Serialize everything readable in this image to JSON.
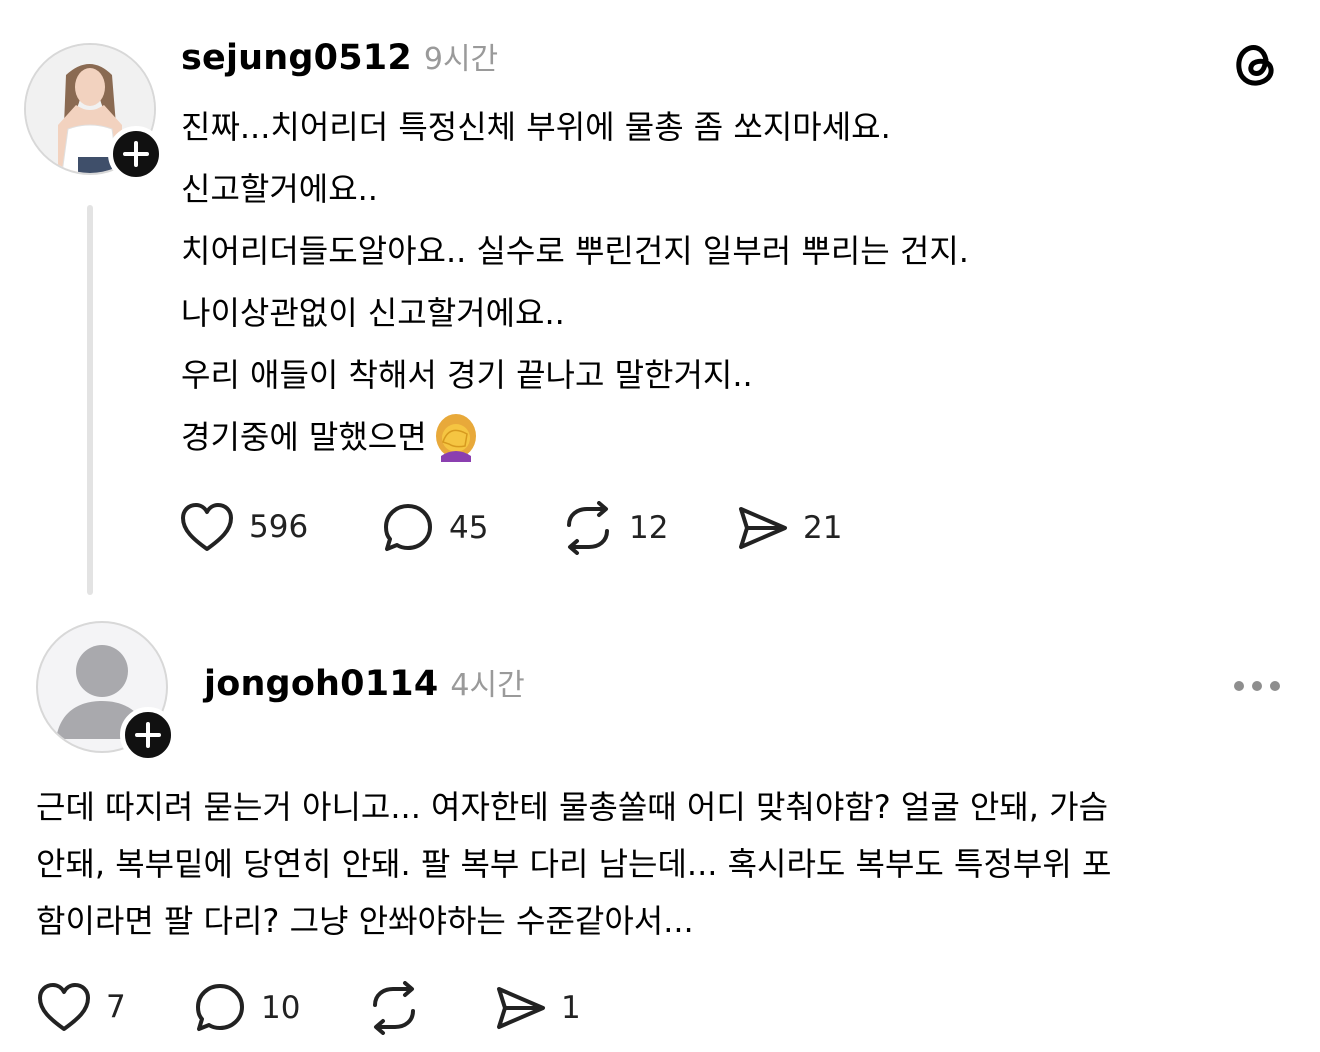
{
  "post": {
    "username": "sejung0512",
    "time": "9시간",
    "lines": [
      "진짜...치어리더 특정신체 부위에 물총 좀 쏘지마세요.",
      "신고할거에요..",
      "치어리더들도알아요.. 실수로 뿌린건지 일부러 뿌리는 건지.",
      "나이상관없이 신고할거에요..",
      "우리 애들이 착해서 경기 끝나고 말한거지..",
      "경기중에 말했으면"
    ],
    "emoji": "face-palm-woman-emoji",
    "stats": {
      "likes": "596",
      "comments": "45",
      "reposts": "12",
      "shares": "21"
    }
  },
  "reply": {
    "username": "jongoh0114",
    "time": "4시간",
    "lines": [
      "근데 따지려 묻는거 아니고... 여자한테 물총쏠때 어디 맞춰야함? 얼굴 안돼, 가슴",
      "안돼, 복부밑에 당연히 안돼. 팔 복부 다리 남는데... 혹시라도 복부도 특정부위 포",
      "함이라면 팔 다리? 그냥 안쏴야하는 수준같아서..."
    ],
    "stats": {
      "likes": "7",
      "comments": "10",
      "shares": "1"
    }
  },
  "icons": {
    "threads": "threads-logo-icon",
    "more": "more-options-icon",
    "like": "heart-icon",
    "comment": "comment-bubble-icon",
    "repost": "repost-icon",
    "share": "send-icon",
    "follow": "plus-icon"
  },
  "colors": {
    "muted": "#9a9a9a",
    "thread_line": "#e3e3e3"
  }
}
